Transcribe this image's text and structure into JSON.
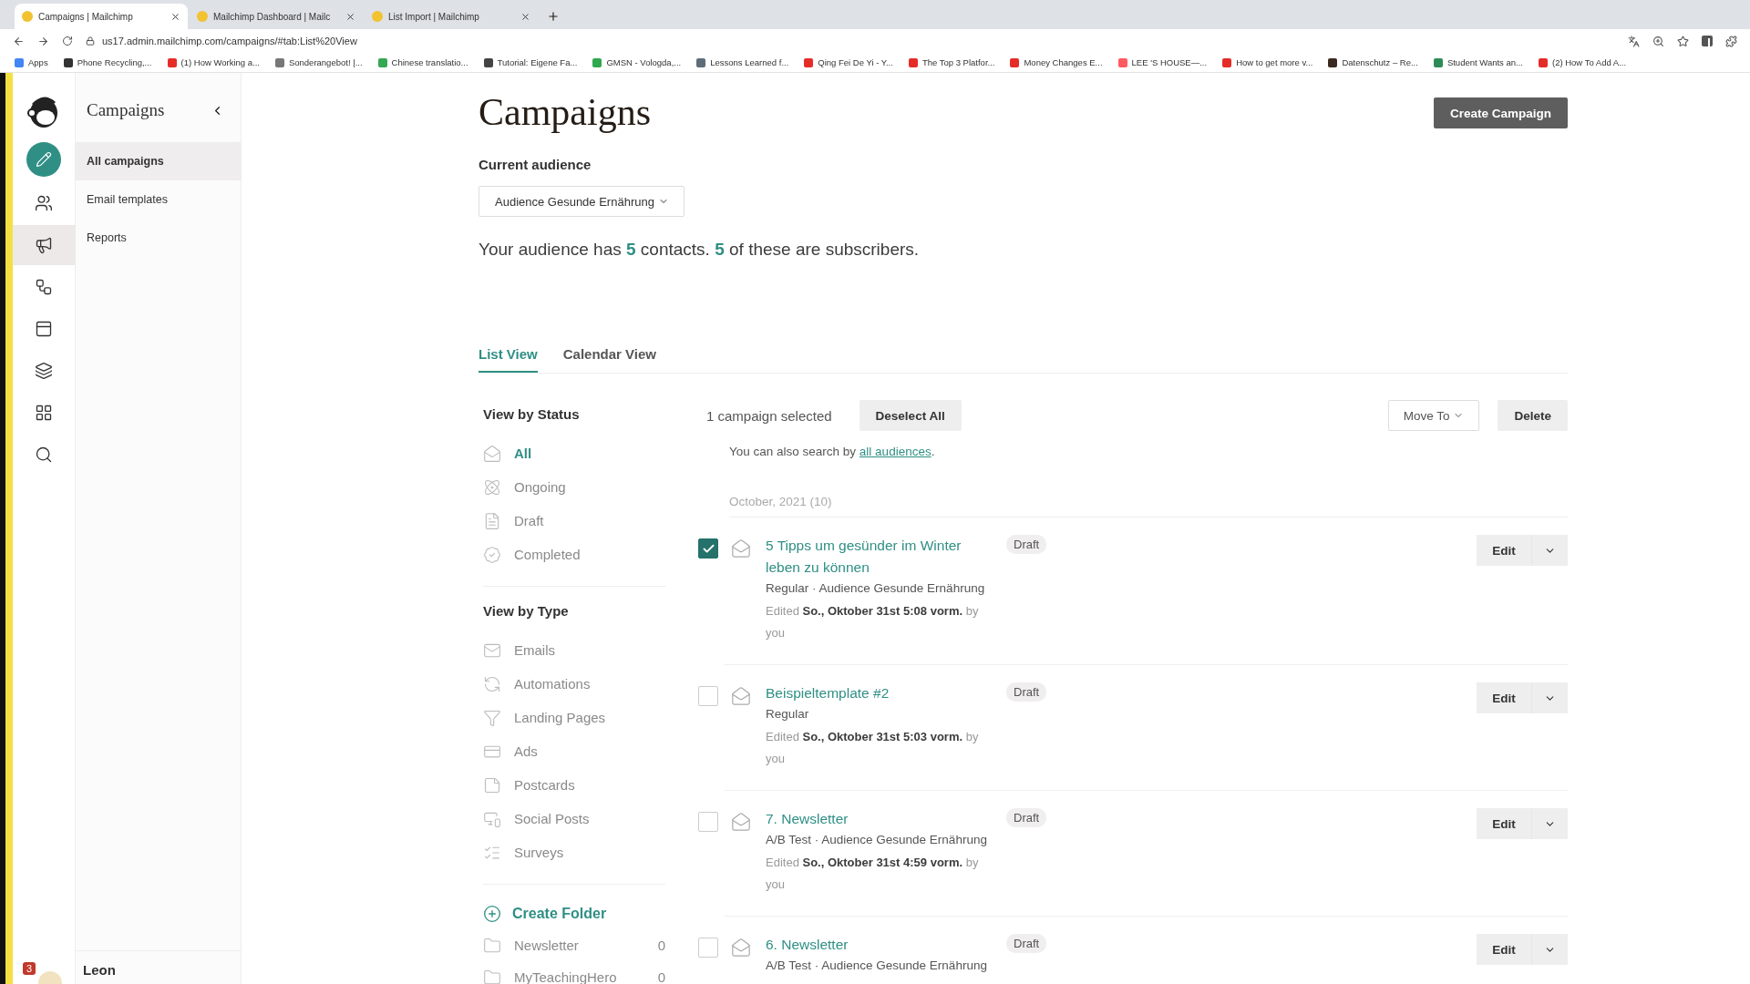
{
  "browser": {
    "tabs": [
      {
        "title": "Campaigns | Mailchimp",
        "selected": true
      },
      {
        "title": "Mailchimp Dashboard | Mailc",
        "selected": false
      },
      {
        "title": "List Import | Mailchimp",
        "selected": false
      }
    ],
    "url": "us17.admin.mailchimp.com/campaigns/#tab:List%20View",
    "bookmarks": [
      {
        "label": "Apps",
        "color": "#4285f4"
      },
      {
        "label": "Phone Recycling,...",
        "color": "#333333"
      },
      {
        "label": "(1) How Working a...",
        "color": "#e52d27"
      },
      {
        "label": "Sonderangebot! |...",
        "color": "#777777"
      },
      {
        "label": "Chinese translatio...",
        "color": "#34a853"
      },
      {
        "label": "Tutorial: Eigene Fa...",
        "color": "#444444"
      },
      {
        "label": "GMSN - Vologda,...",
        "color": "#2fa84f"
      },
      {
        "label": "Lessons Learned f...",
        "color": "#5f6d7a"
      },
      {
        "label": "Qing Fei De Yi - Y...",
        "color": "#e52d27"
      },
      {
        "label": "The Top 3 Platfor...",
        "color": "#e52d27"
      },
      {
        "label": "Money Changes E...",
        "color": "#e52d27"
      },
      {
        "label": "LEE 'S HOUSE—...",
        "color": "#ff5a5f"
      },
      {
        "label": "How to get more v...",
        "color": "#e52d27"
      },
      {
        "label": "Datenschutz – Re...",
        "color": "#3a2a20"
      },
      {
        "label": "Student Wants an...",
        "color": "#2e8b57"
      },
      {
        "label": "(2) How To Add A...",
        "color": "#e52d27"
      }
    ]
  },
  "rail": [
    {
      "kind": "create"
    },
    {
      "kind": "nav",
      "selected": false
    },
    {
      "kind": "nav",
      "selected": true
    },
    {
      "kind": "nav",
      "selected": false
    },
    {
      "kind": "nav",
      "selected": false
    },
    {
      "kind": "nav",
      "selected": false
    },
    {
      "kind": "nav",
      "selected": false
    },
    {
      "kind": "nav",
      "selected": false
    }
  ],
  "nav": {
    "title": "Campaigns",
    "items": [
      {
        "label": "All campaigns",
        "selected": true
      },
      {
        "label": "Email templates",
        "selected": false
      },
      {
        "label": "Reports",
        "selected": false
      }
    ]
  },
  "user": {
    "name": "Leon",
    "notifications": "3"
  },
  "page": {
    "title": "Campaigns",
    "create_button": "Create Campaign",
    "audience_label": "Current audience",
    "audience_select": "Audience Gesunde Ernährung",
    "summary": [
      {
        "kind": "text",
        "text": "Your audience has "
      },
      {
        "kind": "count",
        "text": "5"
      },
      {
        "kind": "text",
        "text": " contacts. "
      },
      {
        "kind": "count",
        "text": "5"
      },
      {
        "kind": "text",
        "text": " of these are subscribers."
      }
    ]
  },
  "view_tabs": [
    {
      "label": "List View",
      "selected": true
    },
    {
      "label": "Calendar View",
      "selected": false
    }
  ],
  "filters": {
    "status_heading": "View by Status",
    "status": [
      {
        "label": "All",
        "selected": true
      },
      {
        "label": "Ongoing",
        "selected": false
      },
      {
        "label": "Draft",
        "selected": false
      },
      {
        "label": "Completed",
        "selected": false
      }
    ],
    "type_heading": "View by Type",
    "types": [
      "Emails",
      "Automations",
      "Landing Pages",
      "Ads",
      "Postcards",
      "Social Posts",
      "Surveys"
    ],
    "create_folder": "Create Folder",
    "folders": [
      {
        "name": "Newsletter",
        "count": "0"
      },
      {
        "name": "MyTeachingHero",
        "count": "0"
      }
    ]
  },
  "toolbar": {
    "selected_count": "1 campaign selected",
    "deselect": "Deselect All",
    "move_to": "Move To",
    "delete": "Delete"
  },
  "search_hint": {
    "text": "You can also search by ",
    "link": "all audiences",
    "end": "."
  },
  "group_label": "October, 2021 (10)",
  "campaigns": [
    {
      "title": "5 Tipps um gesünder im Winter leben zu können",
      "checked": true,
      "meta": "Regular · Audience Gesunde Ernährung",
      "edited": "Edited **So., Oktober 31st 5:08 vorm.** by you",
      "status": "Draft",
      "action": "Edit"
    },
    {
      "title": "Beispieltemplate #2",
      "checked": false,
      "meta": "Regular",
      "edited": "Edited **So., Oktober 31st 5:03 vorm.** by you",
      "status": "Draft",
      "action": "Edit"
    },
    {
      "title": "7. Newsletter",
      "checked": false,
      "meta": "A/B Test · Audience Gesunde Ernährung",
      "edited": "Edited **So., Oktober 31st 4:59 vorm.** by you",
      "status": "Draft",
      "action": "Edit"
    },
    {
      "title": "6. Newsletter",
      "checked": false,
      "meta": "A/B Test · Audience Gesunde Ernährung",
      "status": "Draft",
      "action": "Edit"
    }
  ]
}
